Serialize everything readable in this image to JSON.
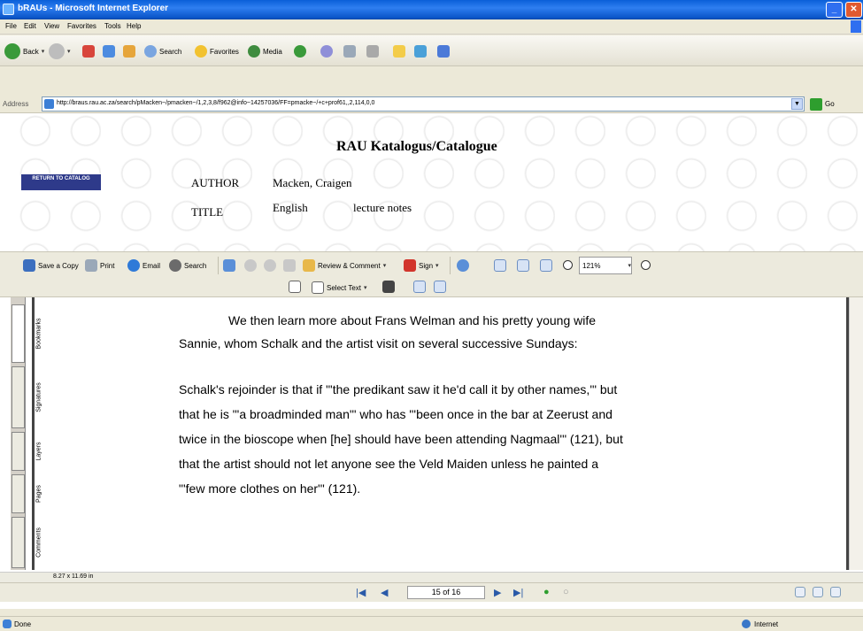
{
  "window": {
    "title": "bRAUs - Microsoft Internet Explorer"
  },
  "menu": {
    "items": [
      "File",
      "Edit",
      "View",
      "Favorites",
      "Tools",
      "Help"
    ]
  },
  "toolbar": {
    "back": "Back",
    "search": "Search",
    "favorites": "Favorites",
    "media": "Media"
  },
  "address": {
    "label": "Address",
    "url": "http://braus.rau.ac.za/search/pMacken~/pmacken~/1,2,3,8/f962@info~14257036/FF=pmacke~/+c+prof61,,2,114,0,0",
    "go_label": "Go"
  },
  "catalogue": {
    "title": "RAU Katalogus/Catalogue",
    "return_button": "RETURN TO CATALOG",
    "author_label": "AUTHOR",
    "author_value": "Macken, Craigen",
    "title_label": "TITLE",
    "title_value_1": "English",
    "title_value_2": "lecture notes"
  },
  "acrobat": {
    "save_copy": "Save a Copy",
    "print": "Print",
    "email": "Email",
    "search": "Search",
    "review": "Review & Comment",
    "sign": "Sign",
    "zoom": "121%",
    "select_text": "Select Text"
  },
  "nav_tabs": [
    "Bookmarks",
    "Signatures",
    "Layers",
    "Pages",
    "Comments"
  ],
  "document": {
    "lines": [
      "We then learn more about Frans Welman and his pretty young wife",
      "Sannie, whom Schalk and the artist visit on several successive Sundays:",
      "Schalk's rejoinder is that if \"'the predikant saw it he'd call it by other names,'\" but",
      "that he is \"'a broadminded man'\" who has \"'been once in the bar at Zeerust and",
      "twice in the bioscope when [he] should have been attending Nagmaal'\" (121), but",
      "that the artist should not let anyone see the Veld Maiden unless he painted a",
      "\"'few more clothes on her'\" (121)."
    ]
  },
  "page_size": "8.27 x 11.69 in",
  "page_indicator": "15 of 16",
  "status": {
    "left": "Done",
    "right": "Internet"
  }
}
